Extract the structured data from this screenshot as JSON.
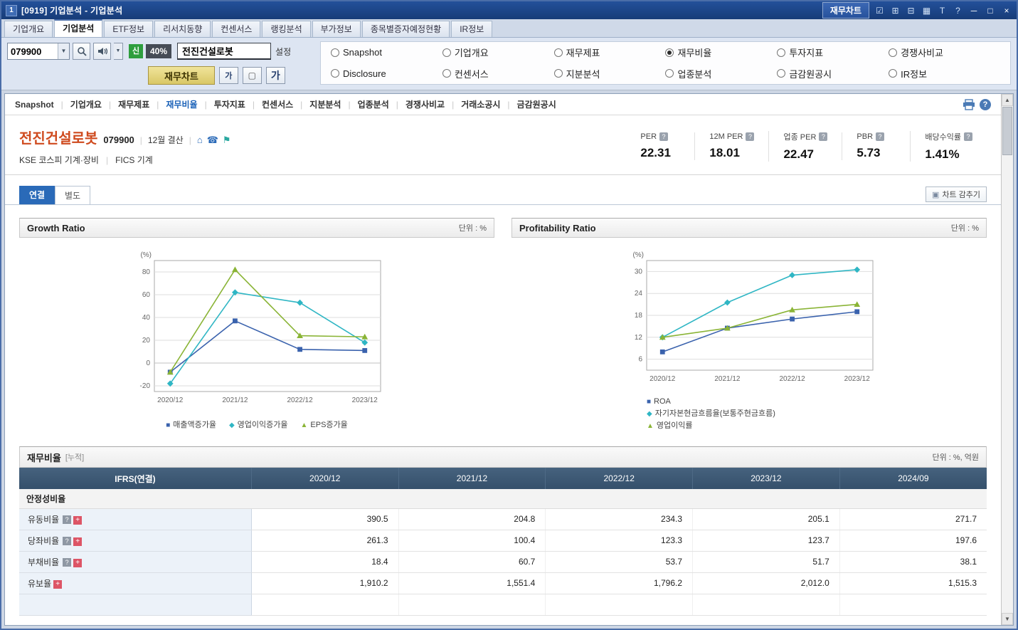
{
  "window": {
    "title": "[0919] 기업분석 - 기업분석",
    "app_icon": "1",
    "titlebar": {
      "chart_button": "재무차트"
    }
  },
  "main_tabs": {
    "items": [
      {
        "label": "기업개요"
      },
      {
        "label": "기업분석"
      },
      {
        "label": "ETF정보"
      },
      {
        "label": "리서치동향"
      },
      {
        "label": "컨센서스"
      },
      {
        "label": "랭킹분석"
      },
      {
        "label": "부가정보"
      },
      {
        "label": "종목별증자예정현황"
      },
      {
        "label": "IR정보"
      }
    ]
  },
  "toolbar": {
    "stock_code": "079900",
    "new_badge": "신",
    "credit_ratio": "40%",
    "stock_name": "전진건설로봇",
    "settings_label": "설정",
    "chart_button": "재무차트",
    "font_small": "가",
    "font_large": "가",
    "radios": {
      "row1": [
        {
          "label": "Snapshot"
        },
        {
          "label": "기업개요"
        },
        {
          "label": "재무제표"
        },
        {
          "label": "재무비율"
        },
        {
          "label": "투자지표"
        },
        {
          "label": "경쟁사비교"
        }
      ],
      "row2": [
        {
          "label": "Disclosure"
        },
        {
          "label": "컨센서스"
        },
        {
          "label": "지분분석"
        },
        {
          "label": "업종분석"
        },
        {
          "label": "금감원공시"
        },
        {
          "label": "IR정보"
        }
      ],
      "selected": "재무비율"
    }
  },
  "subnav": {
    "items": [
      {
        "label": "Snapshot"
      },
      {
        "label": "기업개요"
      },
      {
        "label": "재무제표"
      },
      {
        "label": "재무비율"
      },
      {
        "label": "투자지표"
      },
      {
        "label": "컨센서스"
      },
      {
        "label": "지분분석"
      },
      {
        "label": "업종분석"
      },
      {
        "label": "경쟁사비교"
      },
      {
        "label": "거래소공시"
      },
      {
        "label": "금감원공시"
      }
    ],
    "active": "재무비율"
  },
  "company": {
    "name": "전진건설로봇",
    "code": "079900",
    "settlement": "12월 결산",
    "market": "KSE 코스피 기계·장비",
    "classification": "FICS 기계",
    "metrics": [
      {
        "label": "PER",
        "value": "22.31"
      },
      {
        "label": "12M PER",
        "value": "18.01"
      },
      {
        "label": "업종 PER",
        "value": "22.47"
      },
      {
        "label": "PBR",
        "value": "5.73"
      },
      {
        "label": "배당수익률",
        "value": "1.41%"
      }
    ]
  },
  "view_tabs": {
    "consolidated": "연결",
    "separate": "별도",
    "hide_chart_button": "차트 감추기"
  },
  "chart_data": [
    {
      "type": "line",
      "title": "Growth Ratio",
      "unit_label": "단위 : %",
      "y_axis_label": "(%)",
      "categories": [
        "2020/12",
        "2021/12",
        "2022/12",
        "2023/12"
      ],
      "ylim": [
        -25,
        90
      ],
      "yticks": [
        -20,
        0,
        20,
        40,
        60,
        80
      ],
      "grid": true,
      "legend_position": "bottom-horizontal",
      "series": [
        {
          "name": "매출액증가율",
          "color": "#3a62ad",
          "marker": "square",
          "values": [
            -8,
            37,
            12,
            11
          ]
        },
        {
          "name": "영업이익증가율",
          "color": "#2fb6c4",
          "marker": "diamond",
          "values": [
            -18,
            62,
            53,
            18
          ]
        },
        {
          "name": "EPS증가율",
          "color": "#8ab436",
          "marker": "triangle",
          "values": [
            -8,
            82,
            24,
            23
          ]
        }
      ]
    },
    {
      "type": "line",
      "title": "Profitability Ratio",
      "unit_label": "단위 : %",
      "y_axis_label": "(%)",
      "categories": [
        "2020/12",
        "2021/12",
        "2022/12",
        "2023/12"
      ],
      "ylim": [
        3,
        33
      ],
      "yticks": [
        6,
        12,
        18,
        24,
        30
      ],
      "grid": true,
      "legend_position": "bottom-vertical",
      "series": [
        {
          "name": "ROA",
          "color": "#3a62ad",
          "marker": "square",
          "values": [
            8,
            14.5,
            17,
            19
          ]
        },
        {
          "name": "자기자본현금흐름율(보통주현금흐름)",
          "color": "#2fb6c4",
          "marker": "diamond",
          "values": [
            12,
            21.5,
            29,
            30.5
          ]
        },
        {
          "name": "영업이익률",
          "color": "#8ab436",
          "marker": "triangle",
          "values": [
            12,
            14.5,
            19.5,
            21
          ]
        }
      ]
    }
  ],
  "financial_table": {
    "title": "재무비율",
    "badge": "[누적]",
    "unit": "단위 : %, 억원",
    "columns": [
      "IFRS(연결)",
      "2020/12",
      "2021/12",
      "2022/12",
      "2023/12",
      "2024/09"
    ],
    "section": "안정성비율",
    "rows": [
      {
        "label": "유동비율",
        "has_help": true,
        "values": [
          "390.5",
          "204.8",
          "234.3",
          "205.1",
          "271.7"
        ]
      },
      {
        "label": "당좌비율",
        "has_help": true,
        "values": [
          "261.3",
          "100.4",
          "123.3",
          "123.7",
          "197.6"
        ]
      },
      {
        "label": "부채비율",
        "has_help": true,
        "values": [
          "18.4",
          "60.7",
          "53.7",
          "51.7",
          "38.1"
        ]
      },
      {
        "label": "유보율",
        "has_help": false,
        "values": [
          "1,910.2",
          "1,551.4",
          "1,796.2",
          "2,012.0",
          "1,515.3"
        ]
      }
    ]
  },
  "colors": {
    "titlebar": "#17407c",
    "accent_blue": "#2a6ab8",
    "company_name": "#cf4a1e",
    "table_header_bg": "#3a5772",
    "series_blue": "#3a62ad",
    "series_teal": "#2fb6c4",
    "series_green": "#8ab436"
  }
}
